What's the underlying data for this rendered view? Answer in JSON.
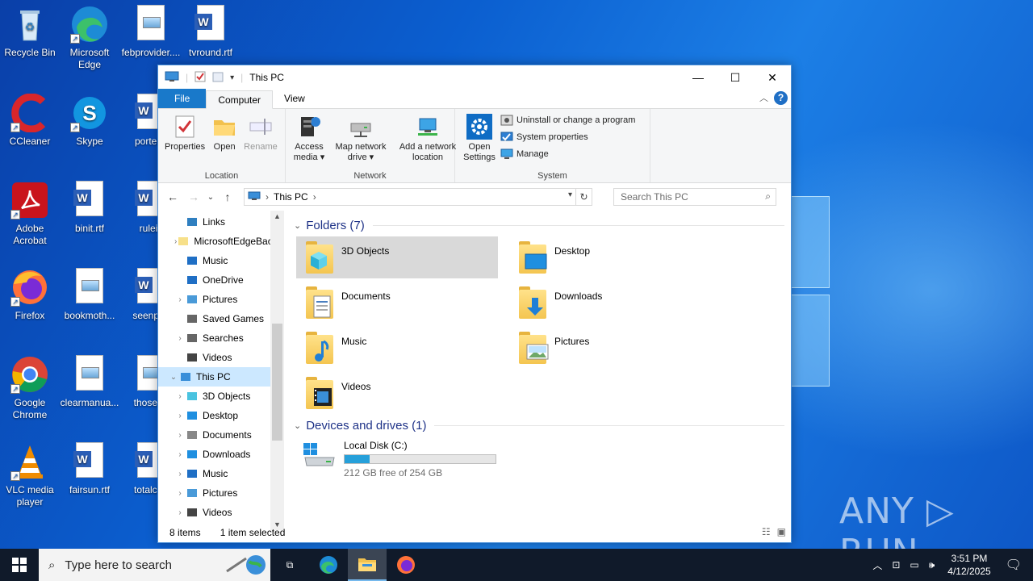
{
  "desktop": {
    "icons": [
      {
        "label": "Recycle Bin"
      },
      {
        "label": "Microsoft Edge"
      },
      {
        "label": "febprovider...."
      },
      {
        "label": "tvround.rtf"
      },
      {
        "label": "CCleaner"
      },
      {
        "label": "Skype"
      },
      {
        "label": "porteith"
      },
      {
        "label": "Adobe Acrobat"
      },
      {
        "label": "binit.rtf"
      },
      {
        "label": "ruleii."
      },
      {
        "label": "Firefox"
      },
      {
        "label": "bookmoth..."
      },
      {
        "label": "seenpas"
      },
      {
        "label": "Google Chrome"
      },
      {
        "label": "clearmanua..."
      },
      {
        "label": "thoseda"
      },
      {
        "label": "VLC media player"
      },
      {
        "label": "fairsun.rtf"
      },
      {
        "label": "totalcha"
      }
    ],
    "watermark": "ANY ▷ RUN"
  },
  "explorer": {
    "title": "This PC",
    "tabs": {
      "file": "File",
      "computer": "Computer",
      "view": "View"
    },
    "help": "?",
    "ribbon": {
      "location": {
        "label": "Location",
        "properties": "Properties",
        "open": "Open",
        "rename": "Rename"
      },
      "network": {
        "label": "Network",
        "access_media": "Access media ▾",
        "map_drive": "Map network drive ▾",
        "add_location": "Add a network location"
      },
      "system": {
        "label": "System",
        "open_settings": "Open Settings",
        "uninstall": "Uninstall or change a program",
        "system_properties": "System properties",
        "manage": "Manage"
      }
    },
    "address": {
      "path": "This PC",
      "search_placeholder": "Search This PC"
    },
    "nav_tree": [
      {
        "label": "Links",
        "exp": ""
      },
      {
        "label": "MicrosoftEdgeBackups",
        "exp": "›"
      },
      {
        "label": "Music",
        "exp": ""
      },
      {
        "label": "OneDrive",
        "exp": ""
      },
      {
        "label": "Pictures",
        "exp": "›"
      },
      {
        "label": "Saved Games",
        "exp": ""
      },
      {
        "label": "Searches",
        "exp": "›"
      },
      {
        "label": "Videos",
        "exp": ""
      },
      {
        "label": "This PC",
        "exp": "⌄"
      },
      {
        "label": "3D Objects",
        "exp": "›"
      },
      {
        "label": "Desktop",
        "exp": "›"
      },
      {
        "label": "Documents",
        "exp": "›"
      },
      {
        "label": "Downloads",
        "exp": "›"
      },
      {
        "label": "Music",
        "exp": "›"
      },
      {
        "label": "Pictures",
        "exp": "›"
      },
      {
        "label": "Videos",
        "exp": "›"
      }
    ],
    "folders_header": "Folders (7)",
    "folders": [
      {
        "label": "3D Objects"
      },
      {
        "label": "Desktop"
      },
      {
        "label": "Documents"
      },
      {
        "label": "Downloads"
      },
      {
        "label": "Music"
      },
      {
        "label": "Pictures"
      },
      {
        "label": "Videos"
      }
    ],
    "drives_header": "Devices and drives (1)",
    "drive": {
      "name": "Local Disk (C:)",
      "free": "212 GB free of 254 GB",
      "used_fraction": 0.165
    },
    "status": {
      "items": "8 items",
      "selected": "1 item selected"
    }
  },
  "taskbar": {
    "search_placeholder": "Type here to search",
    "time": "3:51 PM",
    "date": "4/12/2025"
  }
}
